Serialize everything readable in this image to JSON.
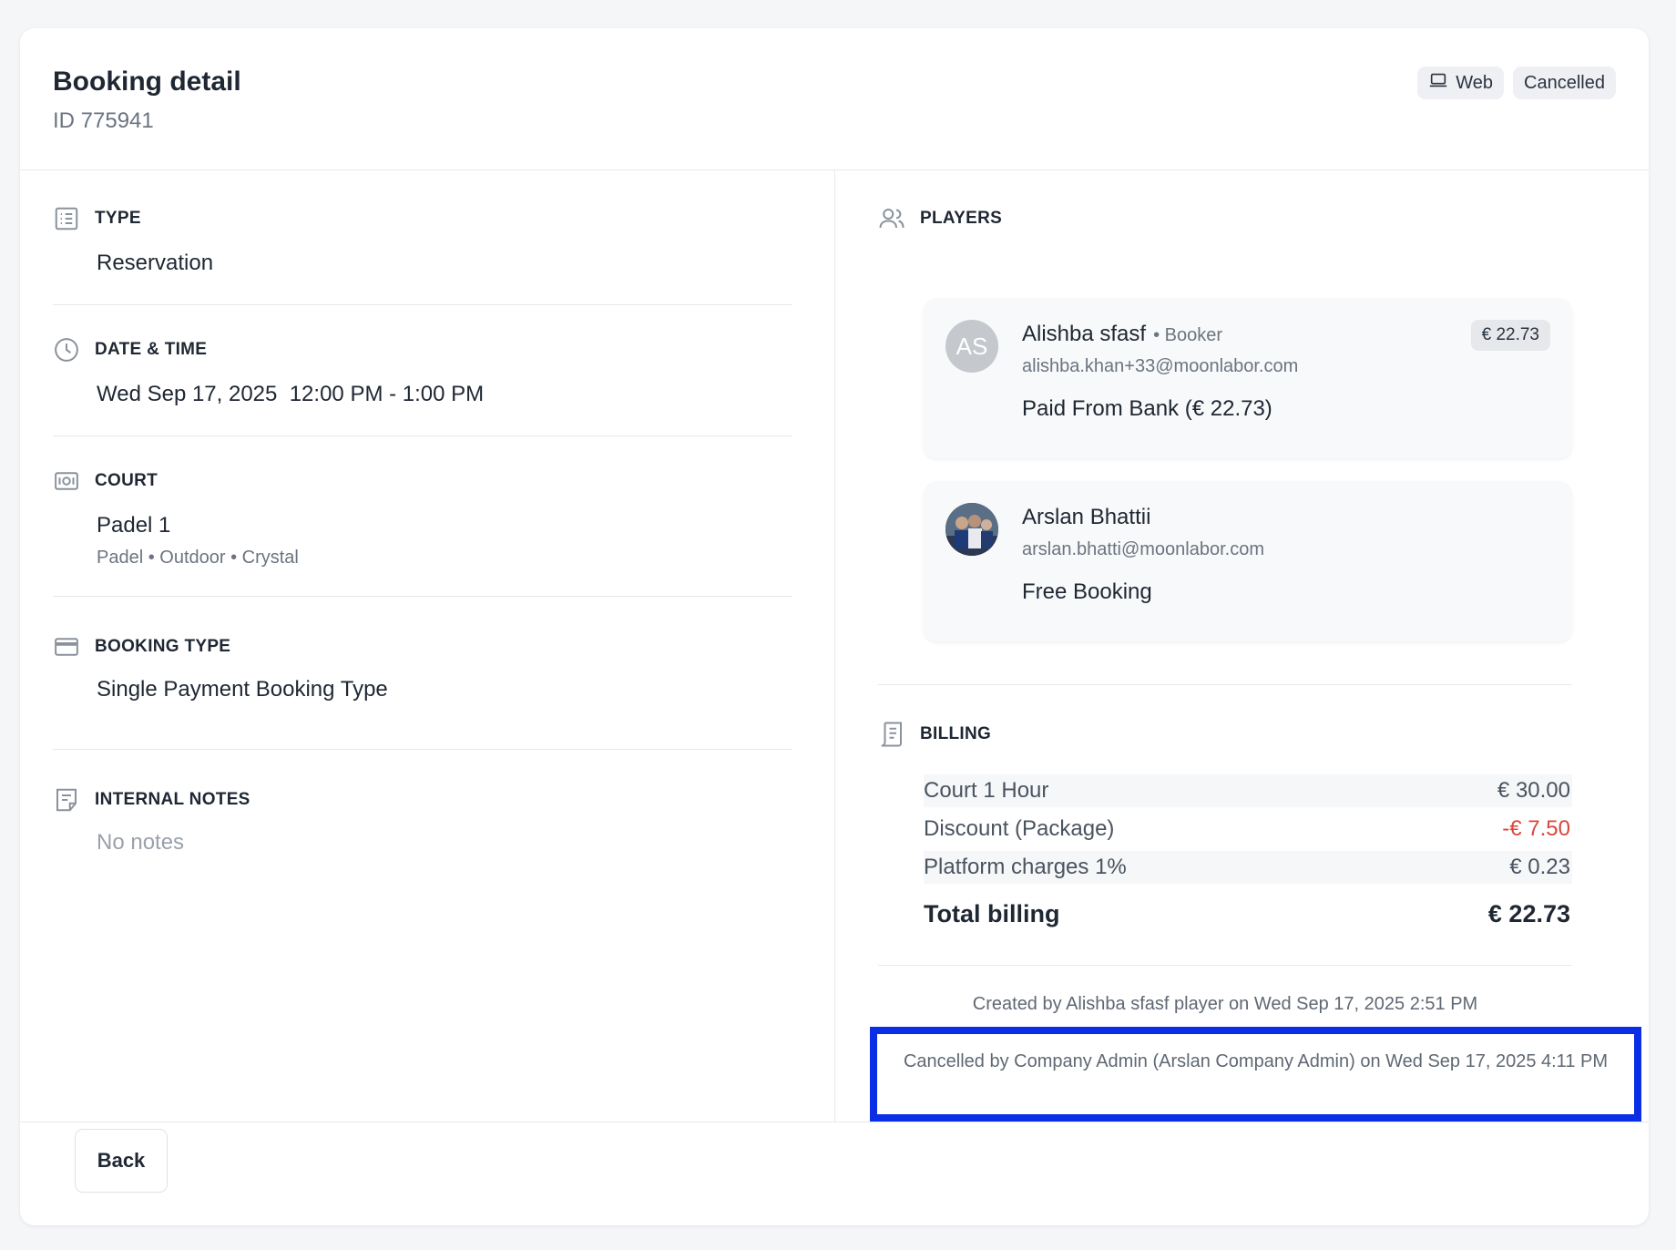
{
  "header": {
    "title": "Booking detail",
    "id_text": "ID 775941",
    "badges": {
      "source": "Web",
      "status": "Cancelled"
    }
  },
  "details": {
    "type": {
      "label": "TYPE",
      "value": "Reservation"
    },
    "datetime": {
      "label": "DATE & TIME",
      "value": "Wed Sep 17, 2025  12:00 PM - 1:00 PM"
    },
    "court": {
      "label": "COURT",
      "value": "Padel 1",
      "sub": "Padel • Outdoor • Crystal"
    },
    "booking_type": {
      "label": "BOOKING TYPE",
      "value": "Single Payment Booking Type"
    },
    "notes": {
      "label": "INTERNAL NOTES",
      "value": "No notes"
    }
  },
  "players": {
    "label": "PLAYERS",
    "items": [
      {
        "initials": "AS",
        "name": "Alishba sfasf",
        "role": "• Booker",
        "email": "alishba.khan+33@moonlabor.com",
        "payment": "Paid From Bank (€ 22.73)",
        "amount": "€ 22.73"
      },
      {
        "name": "Arslan Bhattii",
        "email": "arslan.bhatti@moonlabor.com",
        "payment": "Free Booking"
      }
    ]
  },
  "billing": {
    "label": "BILLING",
    "rows": [
      {
        "label": "Court 1 Hour",
        "amount": "€ 30.00"
      },
      {
        "label": "Discount (Package)",
        "amount": "-€ 7.50"
      },
      {
        "label": "Platform charges 1%",
        "amount": "€ 0.23"
      }
    ],
    "total_label": "Total billing",
    "total_amount": "€ 22.73"
  },
  "audit": {
    "created": "Created by Alishba sfasf player on Wed Sep 17, 2025 2:51 PM",
    "cancelled": "Cancelled by Company Admin (Arslan Company Admin) on Wed Sep 17, 2025 4:11 PM"
  },
  "footer": {
    "back_label": "Back"
  },
  "colors": {
    "accent_highlight": "#0a2de6",
    "negative": "#d9473b",
    "muted": "#6b7480"
  }
}
